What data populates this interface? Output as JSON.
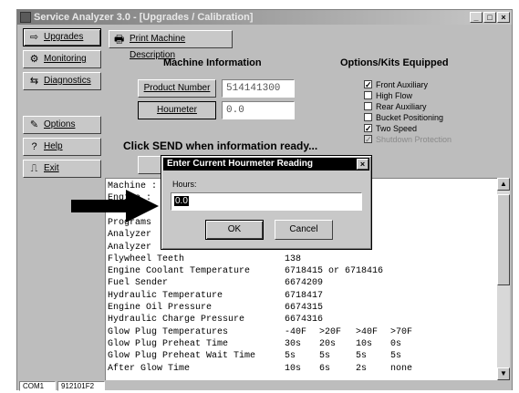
{
  "window": {
    "title": "Service Analyzer 3.0 - [Upgrades / Calibration]",
    "min": "_",
    "max": "□",
    "close": "×"
  },
  "nav": [
    {
      "label": "Upgrades",
      "icon": "upgrade-icon",
      "glyph": "⇨"
    },
    {
      "label": "Monitoring",
      "icon": "gauges-icon",
      "glyph": "⚙"
    },
    {
      "label": "Diagnostics",
      "icon": "diagnostics-icon",
      "glyph": "⇆"
    },
    {
      "label": "Options",
      "icon": "options-icon",
      "glyph": "✎"
    },
    {
      "label": "Help",
      "icon": "help-icon",
      "glyph": "?"
    },
    {
      "label": "Exit",
      "icon": "exit-icon",
      "glyph": "⎍"
    }
  ],
  "toolbar": {
    "print_label": "Print Machine Description",
    "print_icon": "printer-icon"
  },
  "machine": {
    "heading": "Machine Information",
    "product_button": "Product Number",
    "product_value": "514141300",
    "hourmeter_button": "Houmeter",
    "hourmeter_value": "0.0",
    "hint": "Click SEND when information ready..."
  },
  "options": {
    "heading": "Options/Kits Equipped",
    "items": [
      {
        "label": "Front Auxiliary",
        "checked": true,
        "disabled": false
      },
      {
        "label": "High Flow",
        "checked": false,
        "disabled": false
      },
      {
        "label": "Rear Auxiliary",
        "checked": false,
        "disabled": false
      },
      {
        "label": "Bucket Positioning",
        "checked": false,
        "disabled": false
      },
      {
        "label": "Two Speed",
        "checked": true,
        "disabled": false
      },
      {
        "label": "Shutdown Protection",
        "checked": true,
        "disabled": true
      }
    ]
  },
  "output": {
    "lines": [
      {
        "label": "Machine :",
        "v": []
      },
      {
        "label": "Engine :",
        "v": []
      },
      {
        "label": "E",
        "v": []
      },
      {
        "label": "Programs",
        "v": []
      },
      {
        "label": "Analyzer",
        "v": []
      },
      {
        "label": "Analyzer",
        "v": []
      },
      {
        "label": "Flywheel Teeth",
        "v": [
          "138"
        ]
      },
      {
        "label": "Engine Coolant Temperature",
        "v": [
          "6718415 or 6718416"
        ]
      },
      {
        "label": "Fuel Sender",
        "v": [
          "6674209"
        ]
      },
      {
        "label": "Hydraulic Temperature",
        "v": [
          "6718417"
        ]
      },
      {
        "label": "Engine Oil Pressure",
        "v": [
          "6674315"
        ]
      },
      {
        "label": "Hydraulic Charge Pressure",
        "v": [
          "6674316"
        ]
      },
      {
        "label": "Glow Plug Temperatures",
        "v": [
          "-40F",
          ">20F",
          ">40F",
          ">70F"
        ]
      },
      {
        "label": "Glow Plug Preheat Time",
        "v": [
          "30s",
          "20s",
          "10s",
          "0s"
        ]
      },
      {
        "label": "Glow Plug Preheat Wait Time",
        "v": [
          "5s",
          "5s",
          "5s",
          "5s"
        ]
      },
      {
        "label": "After Glow Time",
        "v": [
          "10s",
          "6s",
          "2s",
          "none"
        ]
      }
    ]
  },
  "scrollbar": {
    "up": "▲",
    "down": "▼"
  },
  "status": {
    "port": "COM1",
    "serial": "912101F2"
  },
  "dialog": {
    "title": "Enter Current Hourmeter Reading",
    "close": "×",
    "label": "Hours:",
    "value": "0.0",
    "ok": "OK",
    "cancel": "Cancel"
  }
}
